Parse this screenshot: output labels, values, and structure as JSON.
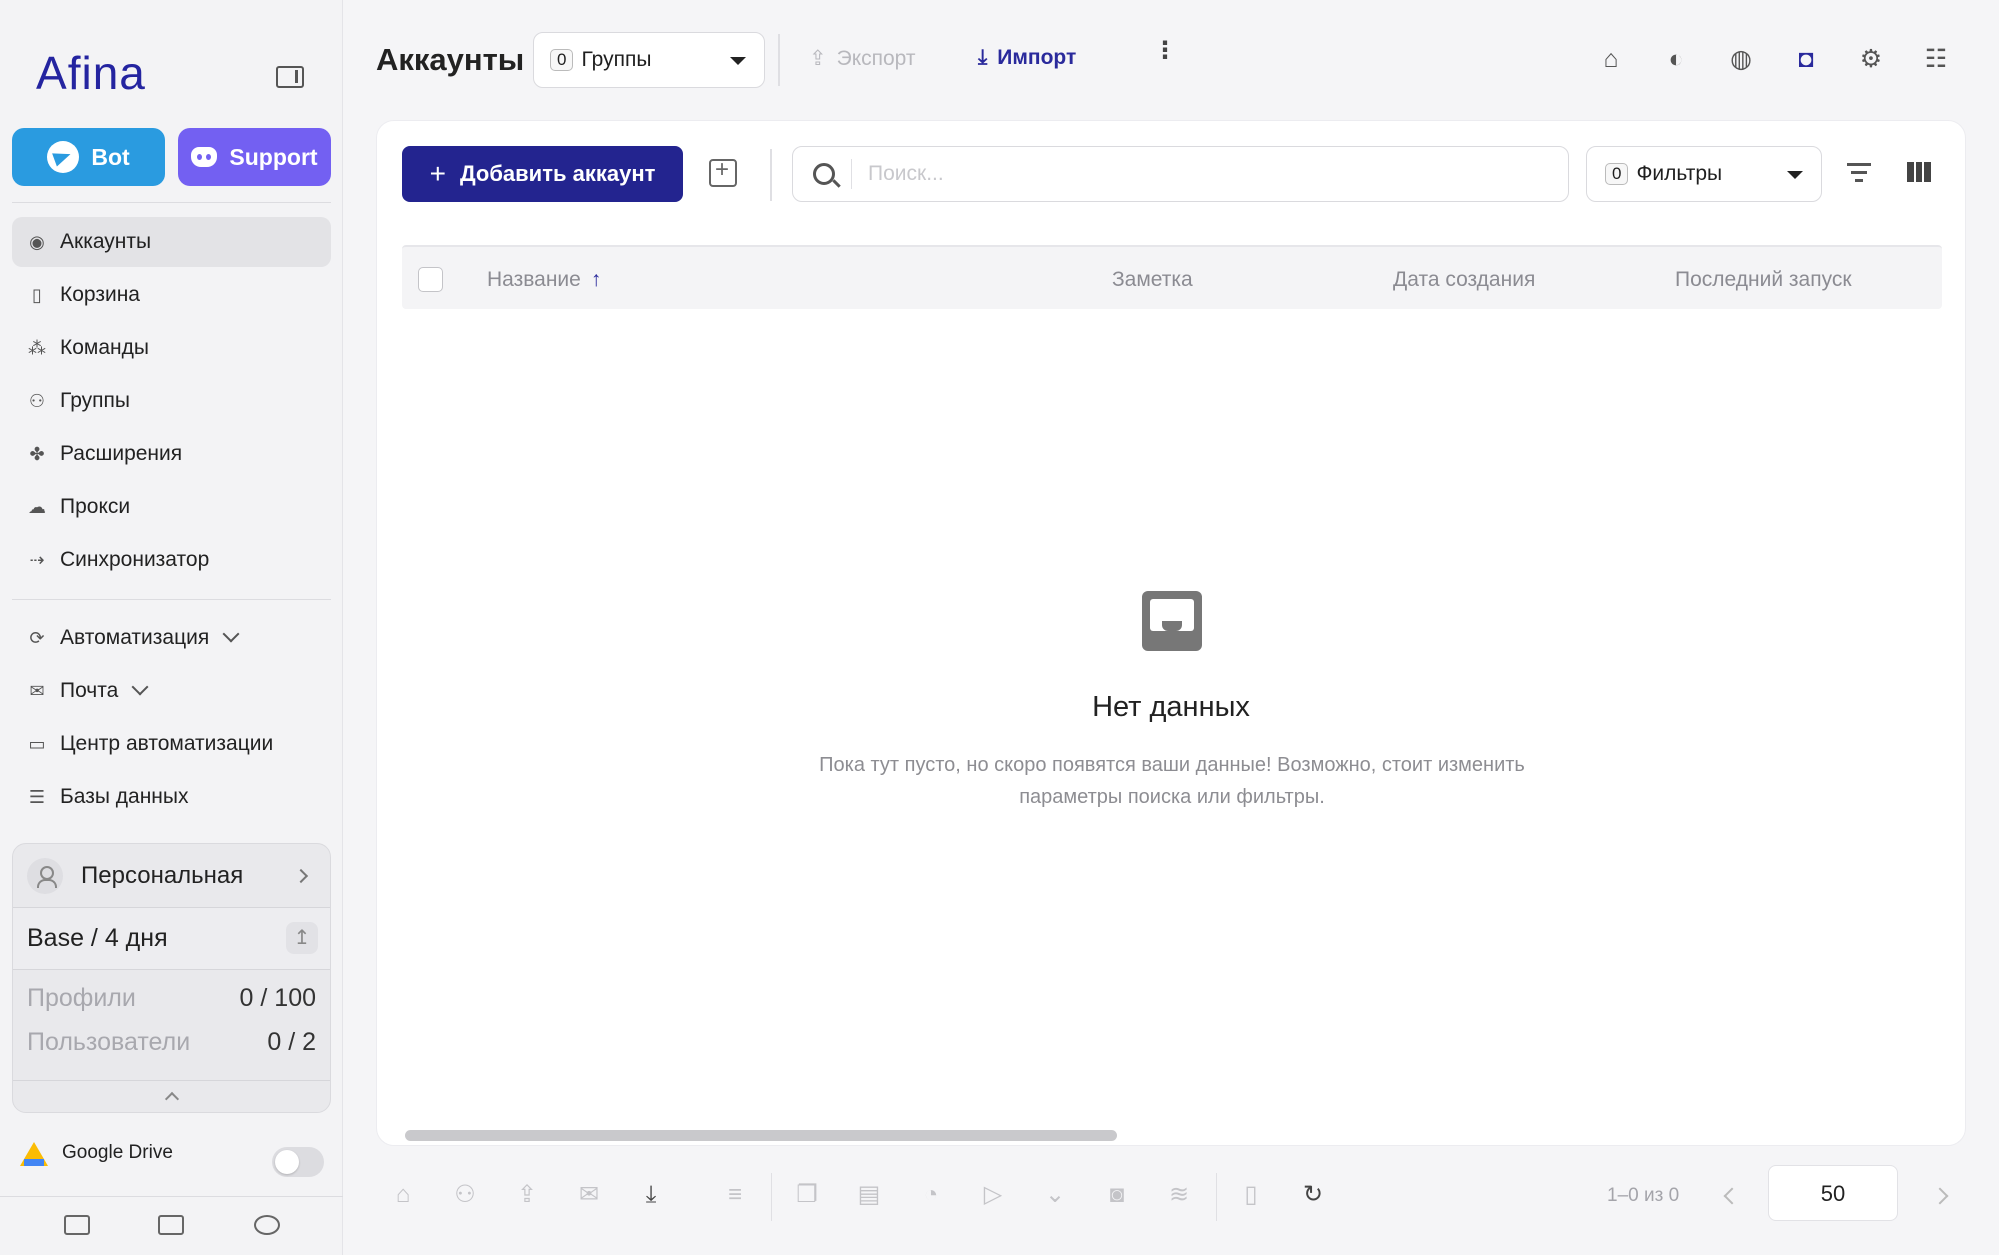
{
  "sidebar": {
    "logo_a": "A",
    "logo_rest": "fina",
    "buttons": {
      "bot": "Bot",
      "support": "Support"
    },
    "items": [
      {
        "label": "Аккаунты",
        "icon": "user-circle-icon",
        "active": true
      },
      {
        "label": "Корзина",
        "icon": "trash-icon"
      },
      {
        "label": "Команды",
        "icon": "team-icon"
      },
      {
        "label": "Группы",
        "icon": "group-icon"
      },
      {
        "label": "Расширения",
        "icon": "puzzle-icon"
      },
      {
        "label": "Прокси",
        "icon": "cloud-icon"
      },
      {
        "label": "Синхронизатор",
        "icon": "sync-icon"
      }
    ],
    "items2": [
      {
        "label": "Автоматизация",
        "icon": "automation-icon",
        "expandable": true
      },
      {
        "label": "Почта",
        "icon": "mail-icon",
        "expandable": true
      },
      {
        "label": "Центр автоматизации",
        "icon": "laptop-icon"
      },
      {
        "label": "Базы данных",
        "icon": "database-icon"
      }
    ],
    "plan": {
      "workspace": "Персональная",
      "tariff": "Base / 4 дня",
      "profiles_label": "Профили",
      "profiles_value": "0 / 100",
      "users_label": "Пользователи",
      "users_value": "0 / 2"
    },
    "gdrive_label": "Google Drive",
    "gdrive_enabled": false
  },
  "topbar": {
    "title": "Аккаунты",
    "groups_count": "0",
    "groups_label": "Группы",
    "export_label": "Экспорт",
    "import_label": "Импорт"
  },
  "toolbar": {
    "add_label": "Добавить аккаунт",
    "search_placeholder": "Поиск...",
    "filters_count": "0",
    "filters_label": "Фильтры"
  },
  "table": {
    "columns": [
      "Название",
      "Заметка",
      "Дата создания",
      "Последний запуск"
    ],
    "sort_indicator": "↑",
    "rows": []
  },
  "empty": {
    "title": "Нет данных",
    "description": "Пока тут пусто, но скоро появятся ваши данные! Возможно, стоит изменить параметры поиска или фильтры."
  },
  "pager": {
    "range": "1–0 из 0",
    "page_size": "50"
  },
  "colors": {
    "brand": "#23248f",
    "bot": "#2a9be0",
    "support": "#7360f2"
  }
}
